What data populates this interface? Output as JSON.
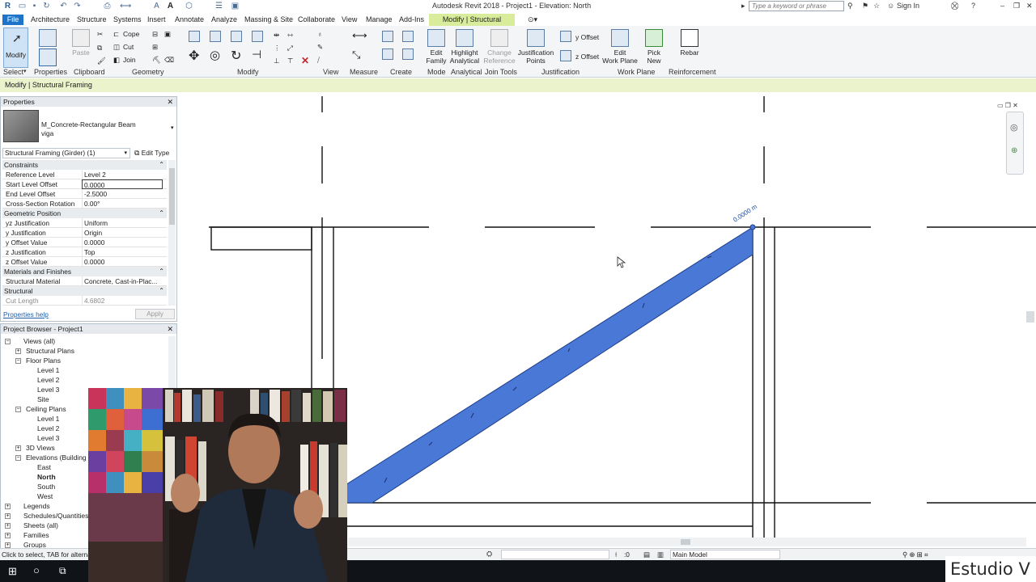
{
  "window": {
    "title": "Autodesk Revit 2018 -    Project1 - Elevation: North",
    "search_placeholder": "Type a keyword or phrase",
    "sign_in": "Sign In"
  },
  "tabs": [
    "Architecture",
    "Structure",
    "Systems",
    "Insert",
    "Annotate",
    "Analyze",
    "Massing & Site",
    "Collaborate",
    "View",
    "Manage",
    "Add-Ins"
  ],
  "tab_file": "File",
  "tab_active": "Modify | Structural Framing",
  "ribbon": {
    "modify": "Modify",
    "paste": "Paste",
    "cope": "Cope",
    "cut": "Cut",
    "join": "Join",
    "edit_family": [
      "Edit",
      "Family"
    ],
    "highlight_analytical": [
      "Highlight",
      "Analytical"
    ],
    "change_reference": [
      "Change",
      "Reference"
    ],
    "justification_points": [
      "Justification",
      "Points"
    ],
    "y_offset": "y Offset",
    "z_offset": "z Offset",
    "edit_work_plane": [
      "Edit",
      "Work Plane"
    ],
    "pick_new": [
      "Pick",
      "New"
    ],
    "rebar": "Rebar",
    "panels": [
      "Select",
      "Properties",
      "Clipboard",
      "Geometry",
      "Modify",
      "View",
      "Measure",
      "Create",
      "Mode",
      "Analytical",
      "Join Tools",
      "Justification",
      "Work Plane",
      "Reinforcement"
    ]
  },
  "context_bar": "Modify | Structural Framing",
  "properties": {
    "title": "Properties",
    "family_name": "M_Concrete-Rectangular Beam",
    "type_name": "viga",
    "selector": "Structural Framing (Girder) (1)",
    "edit_type": "Edit Type",
    "groups": {
      "constraints": "Constraints",
      "geometric_position": "Geometric Position",
      "materials": "Materials and Finishes",
      "structural": "Structural"
    },
    "rows": [
      {
        "k": "Reference Level",
        "v": "Level 2"
      },
      {
        "k": "Start Level Offset",
        "v": "0.0000"
      },
      {
        "k": "End Level Offset",
        "v": "-2.5000"
      },
      {
        "k": "Cross-Section Rotation",
        "v": "0.00°"
      },
      {
        "k": "yz Justification",
        "v": "Uniform"
      },
      {
        "k": "y Justification",
        "v": "Origin"
      },
      {
        "k": "y Offset Value",
        "v": "0.0000"
      },
      {
        "k": "z Justification",
        "v": "Top"
      },
      {
        "k": "z Offset Value",
        "v": "0.0000"
      },
      {
        "k": "Structural Material",
        "v": "Concrete, Cast-in-Plac..."
      },
      {
        "k": "Cut Length",
        "v": "4.6802"
      }
    ],
    "help": "Properties help",
    "apply": "Apply"
  },
  "browser": {
    "title": "Project Browser - Project1",
    "items": [
      "Views (all)",
      "Structural Plans",
      "Floor Plans",
      "Level 1",
      "Level 2",
      "Level 3",
      "Site",
      "Ceiling Plans",
      "Level 1",
      "Level 2",
      "Level 3",
      "3D Views",
      "Elevations (Building El",
      "East",
      "North",
      "South",
      "West",
      "Legends",
      "Schedules/Quantities",
      "Sheets (all)",
      "Families",
      "Groups"
    ]
  },
  "canvas": {
    "dimension_label": "0.0000 m"
  },
  "status": {
    "hint": "Click to select, TAB for alternat",
    "model": "Main Model",
    "scale": ":0"
  },
  "watermark": "Estudio V",
  "colors": {
    "accent": "#1e74c9",
    "context_tab": "#d9ec9c",
    "beam": "#4a78d6"
  }
}
